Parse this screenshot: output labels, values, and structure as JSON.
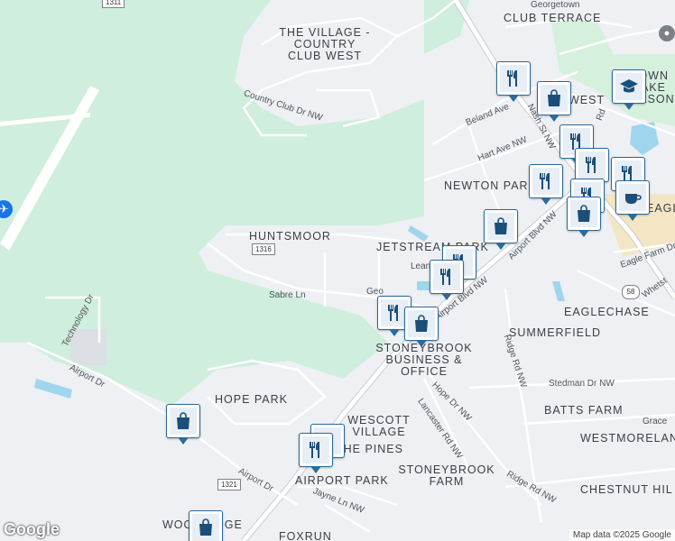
{
  "map": {
    "colors": {
      "background": "#eef0f3",
      "park": "#cfeedd",
      "water": "#9fd6ee",
      "road": "#ffffff",
      "highway": "#f7d97a",
      "pin_border": "#2b6a99"
    },
    "area_labels": [
      {
        "id": "the-village",
        "text": "THE VILLAGE - COUNTRY CLUB WEST"
      },
      {
        "id": "club-terrace",
        "text": "CLUB TERRACE"
      },
      {
        "id": "huntsmoor",
        "text": "HUNTSMOOR"
      },
      {
        "id": "jetstream-park",
        "text": "JETSTREAM PARK"
      },
      {
        "id": "newton-park",
        "text": "NEWTON PARK"
      },
      {
        "id": "eaglechase",
        "text": "EAGLECHASE"
      },
      {
        "id": "summerfield",
        "text": "SUMMERFIELD"
      },
      {
        "id": "stoneybrook-business",
        "text": "STONEYBROOK BUSINESS & OFFICE"
      },
      {
        "id": "hope-park",
        "text": "HOPE PARK"
      },
      {
        "id": "wescott-village",
        "text": "WESCOTT VILLAGE"
      },
      {
        "id": "the-pines",
        "text": "THE PINES"
      },
      {
        "id": "airport-park",
        "text": "AIRPORT PARK"
      },
      {
        "id": "stoneybrook-farm",
        "text": "STONEYBROOK FARM"
      },
      {
        "id": "batts-farm",
        "text": "BATTS FARM"
      },
      {
        "id": "westmoreland",
        "text": "WESTMORELAN"
      },
      {
        "id": "chestnut-hill",
        "text": "CHESTNUT HIL"
      },
      {
        "id": "woodridge",
        "text": "WOODRIDGE"
      },
      {
        "id": "foxrun",
        "text": "FOXRUN"
      },
      {
        "id": "west",
        "text": "WEST"
      },
      {
        "id": "eagle",
        "text": "EAGLE"
      },
      {
        "id": "town-lake-wilson",
        "text": "TOWN LAKE WILSON"
      }
    ],
    "road_labels": [
      {
        "id": "country-club-dr",
        "text": "Country Club Dr NW"
      },
      {
        "id": "sabre-ln",
        "text": "Sabre Ln"
      },
      {
        "id": "technology-dr",
        "text": "Technology Dr"
      },
      {
        "id": "airport-dr-1",
        "text": "Airport Dr"
      },
      {
        "id": "airport-dr-2",
        "text": "Airport Dr"
      },
      {
        "id": "airport-blvd",
        "text": "Airport Blvd NW"
      },
      {
        "id": "airport-blvd-2",
        "text": "Airport Blvd NW"
      },
      {
        "id": "nash-st",
        "text": "Nash St NW"
      },
      {
        "id": "beland-ave",
        "text": "Beland Ave"
      },
      {
        "id": "hart-ave",
        "text": "Hart Ave NW"
      },
      {
        "id": "georgetown",
        "text": "Georgetown"
      },
      {
        "id": "eagle-farm-dr",
        "text": "Eagle Farm Dr"
      },
      {
        "id": "whetstone",
        "text": "Whetst"
      },
      {
        "id": "ridge-rd",
        "text": "Ridge Rd NW"
      },
      {
        "id": "hope-dr",
        "text": "Hope Dr NW"
      },
      {
        "id": "lancaster-rd",
        "text": "Lancaster Rd NW"
      },
      {
        "id": "ridge-rd-2",
        "text": "Ridge Rd NW"
      },
      {
        "id": "stedman-dr",
        "text": "Stedman Dr NW"
      },
      {
        "id": "jayne-ln",
        "text": "Jayne Ln NW"
      },
      {
        "id": "grace",
        "text": "Grace"
      },
      {
        "id": "leam",
        "text": "Lean"
      },
      {
        "id": "geo",
        "text": "Geo"
      },
      {
        "id": "rd",
        "text": "Rd"
      }
    ],
    "route_shields": [
      {
        "id": "sr-1316",
        "text": "1316"
      },
      {
        "id": "sr-1321",
        "text": "1321"
      },
      {
        "id": "sr-1311",
        "text": "1311"
      },
      {
        "id": "us-58",
        "text": "58"
      }
    ],
    "poi_pins": [
      {
        "id": "restaurant-nash",
        "icon": "restaurant-icon"
      },
      {
        "id": "shopping-west",
        "icon": "shopping-bag-icon"
      },
      {
        "id": "school-town",
        "icon": "school-icon"
      },
      {
        "id": "restaurant-hart-1",
        "icon": "restaurant-icon"
      },
      {
        "id": "restaurant-hart-2",
        "icon": "restaurant-icon"
      },
      {
        "id": "restaurant-newton",
        "icon": "restaurant-icon"
      },
      {
        "id": "restaurant-eagle-1",
        "icon": "restaurant-icon"
      },
      {
        "id": "restaurant-eagle-2",
        "icon": "restaurant-icon"
      },
      {
        "id": "cafe-eagle",
        "icon": "coffee-icon"
      },
      {
        "id": "shopping-airport-blvd",
        "icon": "shopping-bag-icon"
      },
      {
        "id": "shopping-jetstream",
        "icon": "shopping-bag-icon"
      },
      {
        "id": "restaurant-jetstream-1",
        "icon": "restaurant-icon"
      },
      {
        "id": "restaurant-jetstream-2",
        "icon": "restaurant-icon"
      },
      {
        "id": "restaurant-stoneybrook",
        "icon": "restaurant-icon"
      },
      {
        "id": "shopping-stoneybrook",
        "icon": "shopping-bag-icon"
      },
      {
        "id": "shopping-hope-park",
        "icon": "shopping-bag-icon"
      },
      {
        "id": "restaurant-wescott-1",
        "icon": "restaurant-icon"
      },
      {
        "id": "restaurant-wescott-2",
        "icon": "restaurant-icon"
      },
      {
        "id": "shopping-woodridge",
        "icon": "shopping-bag-icon"
      }
    ],
    "airport_icon": "airport-icon",
    "place_marker_icon": "place-marker-icon"
  },
  "footer": {
    "logo": "Google",
    "attribution": "Map data ©2025 Google"
  }
}
